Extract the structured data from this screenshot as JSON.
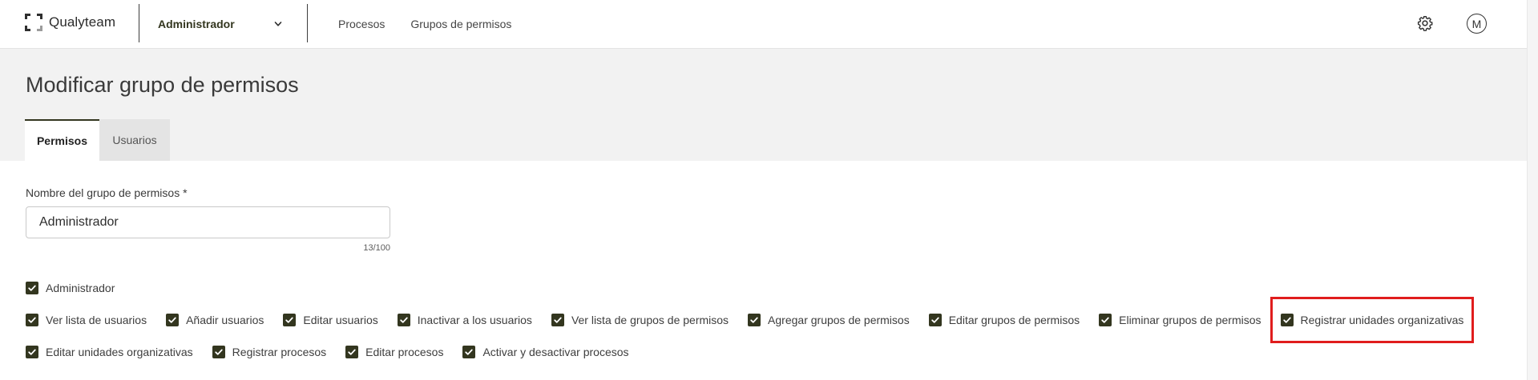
{
  "header": {
    "brand": "Qualyteam",
    "role_selector": "Administrador",
    "nav": [
      "Procesos",
      "Grupos de permisos"
    ],
    "avatar_initial": "M"
  },
  "page": {
    "title": "Modificar grupo de permisos",
    "tabs": [
      {
        "label": "Permisos",
        "active": true
      },
      {
        "label": "Usuarios",
        "active": false
      }
    ]
  },
  "form": {
    "name_label": "Nombre del grupo de permisos *",
    "name_value": "Administrador",
    "counter": "13/100"
  },
  "permissions": {
    "admin": {
      "label": "Administrador",
      "checked": true
    },
    "row1": [
      {
        "label": "Ver lista de usuarios",
        "checked": true
      },
      {
        "label": "Añadir usuarios",
        "checked": true
      },
      {
        "label": "Editar usuarios",
        "checked": true
      },
      {
        "label": "Inactivar a los usuarios",
        "checked": true
      },
      {
        "label": "Ver lista de grupos de permisos",
        "checked": true
      },
      {
        "label": "Agregar grupos de permisos",
        "checked": true
      },
      {
        "label": "Editar grupos de permisos",
        "checked": true
      },
      {
        "label": "Eliminar grupos de permisos",
        "checked": true
      },
      {
        "label": "Registrar unidades organizativas",
        "checked": true
      }
    ],
    "row2": [
      {
        "label": "Editar unidades organizativas",
        "checked": true
      },
      {
        "label": "Registrar procesos",
        "checked": true
      },
      {
        "label": "Editar procesos",
        "checked": true
      },
      {
        "label": "Activar y desactivar procesos",
        "checked": true
      }
    ]
  },
  "colors": {
    "accent": "#33361f",
    "highlight": "#e01d1d",
    "band": "#f2f2f2"
  },
  "icons": {
    "settings": "gear-icon",
    "dropdown": "chevron-down-icon",
    "checkbox": "check-icon"
  }
}
